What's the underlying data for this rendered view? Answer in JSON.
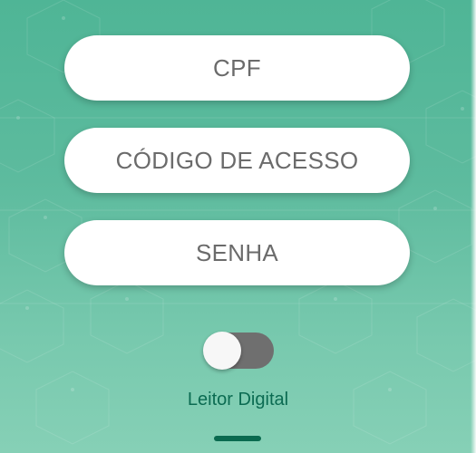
{
  "form": {
    "cpf_placeholder": "CPF",
    "codigo_placeholder": "CÓDIGO DE ACESSO",
    "senha_placeholder": "SENHA"
  },
  "biometric": {
    "label": "Leitor Digital",
    "enabled": false
  },
  "colors": {
    "background_top": "#4fb596",
    "background_bottom": "#86d0b6",
    "label_text": "#0b6b52",
    "toggle_track_off": "#6f6f6f"
  }
}
